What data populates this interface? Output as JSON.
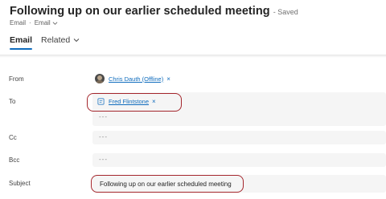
{
  "header": {
    "title": "Following up on our earlier scheduled meeting",
    "save_status": "- Saved",
    "entity_type": "Email",
    "separator": "·",
    "form_name": "Email"
  },
  "tabs": [
    {
      "label": "Email",
      "active": true
    },
    {
      "label": "Related",
      "active": false
    }
  ],
  "fields": {
    "from": {
      "label": "From",
      "recipient": "Chris Dauth (Offline)",
      "remove": "×"
    },
    "to": {
      "label": "To",
      "recipient": "Fred Flintstone",
      "remove": "×",
      "placeholder": "---"
    },
    "cc": {
      "label": "Cc",
      "placeholder": "---"
    },
    "bcc": {
      "label": "Bcc",
      "placeholder": "---"
    },
    "subject": {
      "label": "Subject",
      "value": "Following up on our earlier scheduled meeting"
    }
  },
  "colors": {
    "accent": "#0f6cbd",
    "highlight": "#a4262c",
    "field_bg": "#f5f5f5"
  },
  "icons": [
    "chevron-down-icon",
    "user-avatar",
    "contact-card-icon",
    "close-icon"
  ]
}
